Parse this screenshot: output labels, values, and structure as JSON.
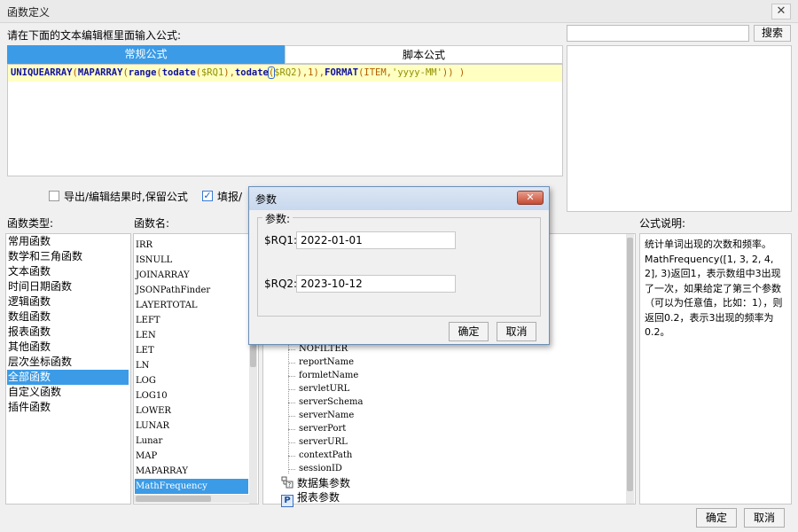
{
  "window": {
    "title": "函数定义",
    "close_glyph": "✕"
  },
  "editor": {
    "prompt": "请在下面的文本编辑框里面输入公式:",
    "tabs": [
      "常规公式",
      "脚本公式"
    ],
    "formula_tokens": [
      {
        "t": "UNIQUEARRAY",
        "c": "kw"
      },
      {
        "t": "(",
        "c": "pn"
      },
      {
        "t": "MAPARRAY",
        "c": "kw"
      },
      {
        "t": "(",
        "c": "pn"
      },
      {
        "t": "range",
        "c": "kw"
      },
      {
        "t": "(",
        "c": "pn"
      },
      {
        "t": "todate",
        "c": "kw"
      },
      {
        "t": "(",
        "c": "pn"
      },
      {
        "t": "$RQ1",
        "c": "var"
      },
      {
        "t": ")",
        "c": "pn"
      },
      {
        "t": ",",
        "c": "pn"
      },
      {
        "t": "todate",
        "c": "kw"
      },
      {
        "t": "(",
        "c": "pn caret"
      },
      {
        "t": "$RQ2",
        "c": "var"
      },
      {
        "t": ")",
        "c": "pn"
      },
      {
        "t": ",1)",
        "c": "pn"
      },
      {
        "t": ",",
        "c": "pn"
      },
      {
        "t": "FORMAT",
        "c": "kw"
      },
      {
        "t": "(",
        "c": "pn"
      },
      {
        "t": "ITEM",
        "c": "pn"
      },
      {
        "t": ",",
        "c": "pn"
      },
      {
        "t": "'yyyy-MM'",
        "c": "str"
      },
      {
        "t": ")) )",
        "c": "pn"
      }
    ]
  },
  "search": {
    "value": "",
    "button_label": "搜索"
  },
  "options": {
    "keep_formula_label": "导出/编辑结果时,保留公式",
    "keep_formula_checked": false,
    "fill_label": "填报/",
    "fill_checked": true
  },
  "function_types": {
    "header": "函数类型:",
    "items": [
      "常用函数",
      "数学和三角函数",
      "文本函数",
      "时间日期函数",
      "逻辑函数",
      "数组函数",
      "报表函数",
      "其他函数",
      "层次坐标函数",
      "全部函数",
      "自定义函数",
      "插件函数"
    ],
    "selected_index": 9
  },
  "function_names": {
    "header": "函数名:",
    "items": [
      "IRR",
      "ISNULL",
      "JOINARRAY",
      "JSONPathFinder",
      "LAYERTOTAL",
      "LEFT",
      "LEN",
      "LET",
      "LN",
      "LOG",
      "LOG10",
      "LOWER",
      "LUNAR",
      "Lunar",
      "MAP",
      "MAPARRAY",
      "MathFrequency"
    ],
    "selected_index": 16
  },
  "param_tree": {
    "items": [
      "NOFILTER",
      "reportName",
      "formletName",
      "servletURL",
      "serverSchema",
      "serverName",
      "serverPort",
      "serverURL",
      "contextPath",
      "sessionID"
    ],
    "folders": [
      {
        "label": "数据集参数",
        "icon": "dataset-param-icon"
      },
      {
        "label": "报表参数",
        "icon": "report-param-icon",
        "glyph": "P"
      }
    ]
  },
  "description": {
    "header": "公式说明:",
    "text": "统计单词出现的次数和频率。MathFrequency([1, 3, 2, 4, 2], 3)返回1，表示数组中3出现了一次，如果给定了第三个参数（可以为任意值，比如：1），则返回0.2，表示3出现的频率为0.2。"
  },
  "footer": {
    "ok_label": "确定",
    "cancel_label": "取消"
  },
  "param_dialog": {
    "title": "参数",
    "group_title": "参数:",
    "fields": [
      {
        "label": "$RQ1:",
        "value": "2022-01-01"
      },
      {
        "label": "$RQ2:",
        "value": "2023-10-12"
      }
    ],
    "ok_label": "确定",
    "cancel_label": "取消"
  }
}
